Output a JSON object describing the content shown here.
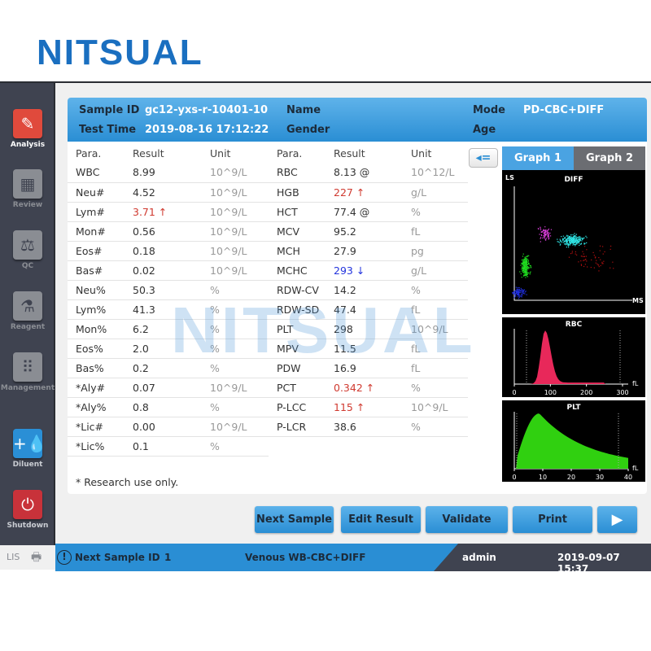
{
  "logo": "NITSUAL",
  "watermark": "NITSUAL",
  "sidebar": {
    "items": [
      {
        "label": "Analysis",
        "icon": "analysis-icon"
      },
      {
        "label": "Review",
        "icon": "review-icon"
      },
      {
        "label": "QC",
        "icon": "scale-icon"
      },
      {
        "label": "Reagent",
        "icon": "flask-icon"
      },
      {
        "label": "Management",
        "icon": "grid-icon"
      },
      {
        "label": "Diluent",
        "icon": "drop-icon"
      },
      {
        "label": "Shutdown",
        "icon": "power-icon"
      }
    ],
    "lis": "LIS"
  },
  "header": {
    "sample_id_label": "Sample ID",
    "sample_id": "gc12-yxs-r-10401-10",
    "test_time_label": "Test Time",
    "test_time": "2019-08-16 17:12:22",
    "name_label": "Name",
    "name": "",
    "gender_label": "Gender",
    "gender": "",
    "mode_label": "Mode",
    "mode": "PD-CBC+DIFF",
    "age_label": "Age",
    "age": ""
  },
  "columns": {
    "para": "Para.",
    "result": "Result",
    "unit": "Unit"
  },
  "left_table": [
    [
      "WBC",
      "8.99",
      "10^9/L",
      ""
    ],
    [
      "Neu#",
      "4.52",
      "10^9/L",
      ""
    ],
    [
      "Lym#",
      "3.71 ↑",
      "10^9/L",
      "hi"
    ],
    [
      "Mon#",
      "0.56",
      "10^9/L",
      ""
    ],
    [
      "Eos#",
      "0.18",
      "10^9/L",
      ""
    ],
    [
      "Bas#",
      "0.02",
      "10^9/L",
      ""
    ],
    [
      "Neu%",
      "50.3",
      "%",
      ""
    ],
    [
      "Lym%",
      "41.3",
      "%",
      ""
    ],
    [
      "Mon%",
      "6.2",
      "%",
      ""
    ],
    [
      "Eos%",
      "2.0",
      "%",
      ""
    ],
    [
      "Bas%",
      "0.2",
      "%",
      ""
    ],
    [
      "*Aly#",
      "0.07",
      "10^9/L",
      ""
    ],
    [
      "*Aly%",
      "0.8",
      "%",
      ""
    ],
    [
      "*Lic#",
      "0.00",
      "10^9/L",
      ""
    ],
    [
      "*Lic%",
      "0.1",
      "%",
      ""
    ]
  ],
  "right_table": [
    [
      "RBC",
      "8.13 @",
      "10^12/L",
      ""
    ],
    [
      "HGB",
      "227 ↑",
      "g/L",
      "hi"
    ],
    [
      "HCT",
      "77.4 @",
      "%",
      ""
    ],
    [
      "MCV",
      "95.2",
      "fL",
      ""
    ],
    [
      "MCH",
      "27.9",
      "pg",
      ""
    ],
    [
      "MCHC",
      "293 ↓",
      "g/L",
      "lo"
    ],
    [
      "RDW-CV",
      "14.2",
      "%",
      ""
    ],
    [
      "RDW-SD",
      "47.4",
      "fL",
      ""
    ],
    [
      "PLT",
      "298",
      "10^9/L",
      ""
    ],
    [
      "MPV",
      "11.5",
      "fL",
      ""
    ],
    [
      "PDW",
      "16.9",
      "fL",
      ""
    ],
    [
      "PCT",
      "0.342 ↑",
      "%",
      "hi"
    ],
    [
      "P-LCC",
      "115 ↑",
      "10^9/L",
      "hi"
    ],
    [
      "P-LCR",
      "38.6",
      "%",
      ""
    ]
  ],
  "note": "* Research use only.",
  "graph_tabs": [
    "Graph 1",
    "Graph 2"
  ],
  "graphs": {
    "diff": {
      "title": "DIFF",
      "y": "LS",
      "x": "MS"
    },
    "rbc": {
      "title": "RBC",
      "unit": "fL",
      "ticks": [
        "0",
        "100",
        "200",
        "300"
      ]
    },
    "plt": {
      "title": "PLT",
      "unit": "fL",
      "ticks": [
        "0",
        "10",
        "20",
        "30",
        "40"
      ]
    }
  },
  "buttons": {
    "next_sample": "Next Sample",
    "edit_result": "Edit Result",
    "validate": "Validate",
    "print": "Print"
  },
  "status": {
    "next_id_label": "Next Sample ID",
    "next_id": "1",
    "mode": "Venous WB-CBC+DIFF",
    "user": "admin",
    "datetime": "2019-09-07 15:37"
  },
  "colors": {
    "accent": "#2a8ed4",
    "sidebar": "#3f4350",
    "high": "#d03a30",
    "low": "#2233dd"
  }
}
